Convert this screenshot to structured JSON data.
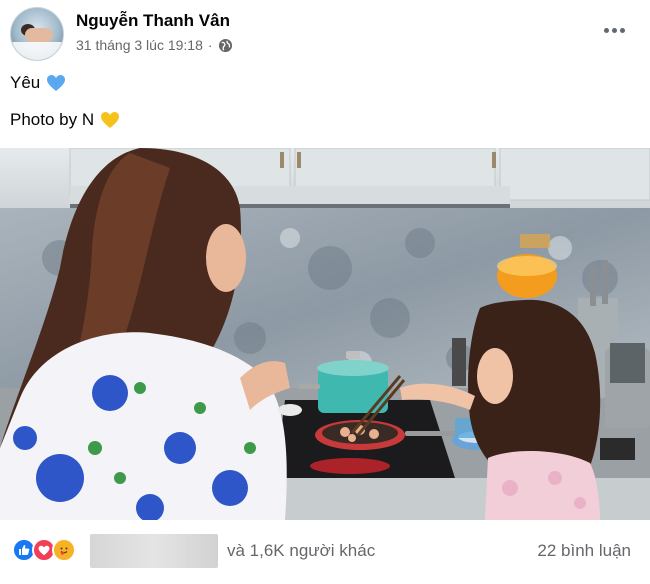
{
  "post": {
    "author": "Nguyễn Thanh Vân",
    "timestamp": "31 tháng 3 lúc 19:18",
    "privacy_icon": "globe-icon",
    "more_icon": "more-options-icon",
    "text_line1": "Yêu",
    "text_line1_emoji": "blue-heart-icon",
    "text_line2": "Photo by N",
    "text_line2_emoji": "yellow-heart-icon"
  },
  "reactions": {
    "icons": [
      "like-icon",
      "love-icon",
      "care-icon"
    ],
    "others_text": "và 1,6K người khác",
    "comments_text": "22 bình luận"
  },
  "colors": {
    "blue_heart": "#5aa9f0",
    "yellow_heart": "#f5c21b",
    "like": "#1877f2",
    "love": "#f33e58",
    "care": "#f7b125",
    "secondary_text": "#65676b"
  }
}
